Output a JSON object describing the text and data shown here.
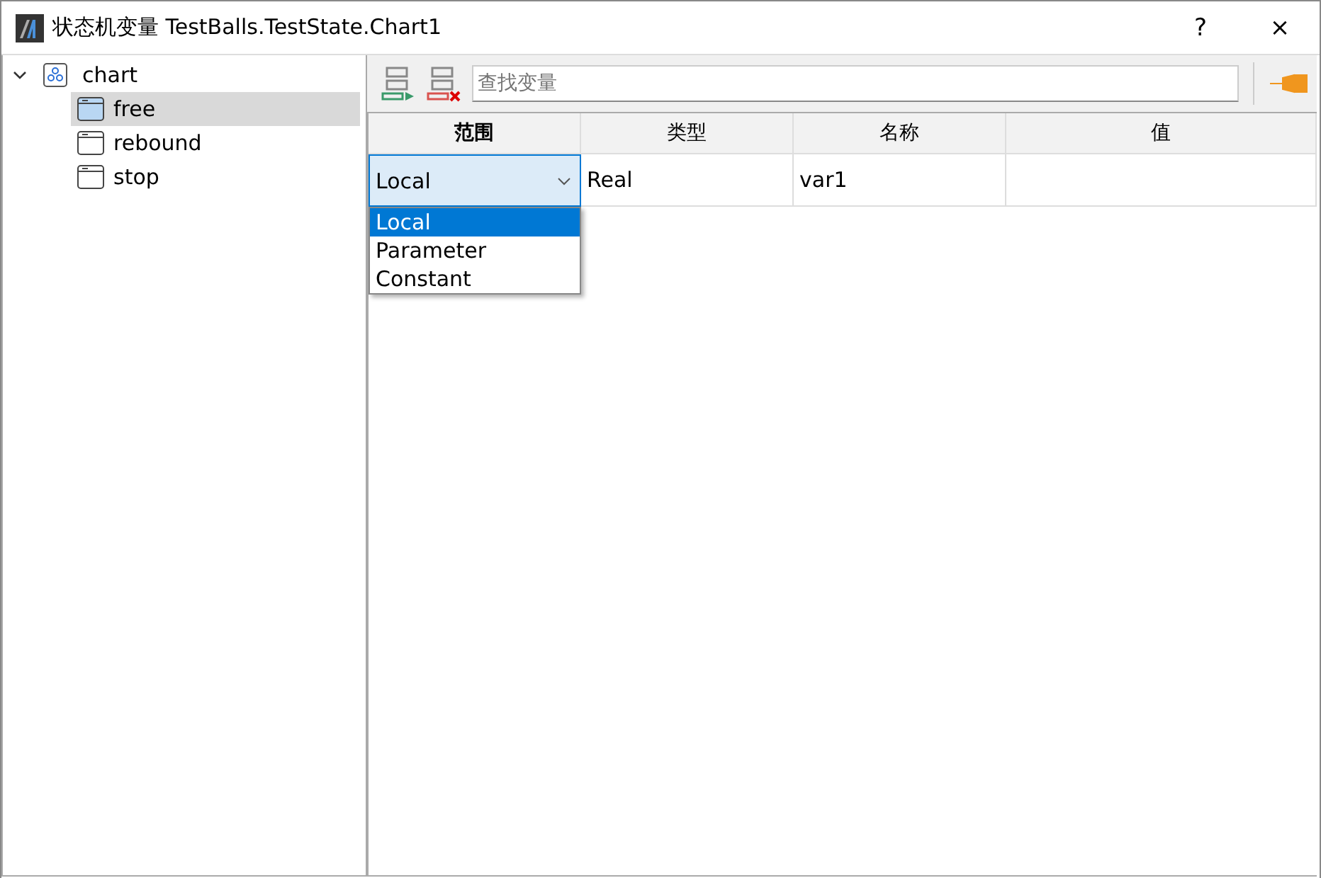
{
  "window": {
    "title": "状态机变量 TestBalls.TestState.Chart1",
    "buttons": [
      "?",
      "×"
    ]
  },
  "tree": [
    {
      "label": "chart",
      "kind": "chart",
      "expanded": true,
      "selected": false,
      "children": [
        {
          "label": "free",
          "kind": "state",
          "selected": true
        },
        {
          "label": "rebound",
          "kind": "state",
          "selected": false
        },
        {
          "label": "stop",
          "kind": "state",
          "selected": false
        }
      ]
    }
  ],
  "toolbar": {
    "search": {
      "placeholder": "查找变量"
    }
  },
  "table": {
    "columns": [
      {
        "label": "范围",
        "selected": true
      },
      {
        "label": "类型",
        "selected": false
      },
      {
        "label": "名称",
        "selected": false
      },
      {
        "label": "值",
        "selected": false
      }
    ],
    "rows": [
      {
        "scope": "Local",
        "type": "Real",
        "name": "var1"
      }
    ]
  },
  "dropdown": {
    "options": [
      {
        "label": "Local",
        "selected": true
      },
      {
        "label": "Parameter",
        "selected": false
      },
      {
        "label": "Constant",
        "selected": false
      }
    ]
  }
}
